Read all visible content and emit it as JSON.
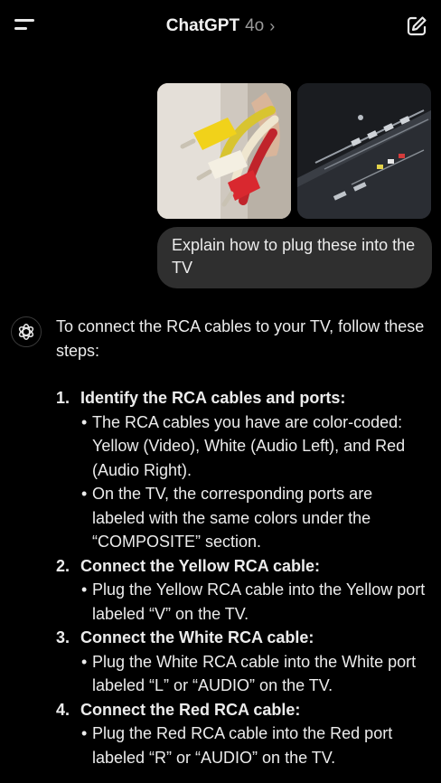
{
  "header": {
    "title": "ChatGPT",
    "model": "4o",
    "chevron": "›",
    "menu_icon": "menu-icon",
    "new_chat_icon": "new-chat-icon"
  },
  "user_message": {
    "attachments": [
      {
        "name": "rca-cables-photo"
      },
      {
        "name": "tv-ports-photo"
      }
    ],
    "text": "Explain how to plug these into the TV"
  },
  "assistant_message": {
    "avatar_icon": "openai-logo-icon",
    "intro": "To connect the RCA cables to your TV, follow these steps:",
    "steps": [
      {
        "num": "1.",
        "title": "Identify the RCA cables and ports:",
        "bullets": [
          "The RCA cables you have are color-coded: Yellow (Video), White (Audio Left), and Red (Audio Right).",
          "On the TV, the corresponding ports are labeled with the same colors under the “COMPOSITE” section."
        ]
      },
      {
        "num": "2.",
        "title": "Connect the Yellow RCA cable:",
        "bullets": [
          "Plug the Yellow RCA cable into the Yellow port labeled “V” on the TV."
        ]
      },
      {
        "num": "3.",
        "title": "Connect the White RCA cable:",
        "bullets": [
          "Plug the White RCA cable into the White port labeled “L” or “AUDIO” on the TV."
        ]
      },
      {
        "num": "4.",
        "title": "Connect the Red RCA cable:",
        "bullets": [
          "Plug the Red RCA cable into the Red port labeled “R” or “AUDIO” on the TV."
        ]
      }
    ]
  },
  "colors": {
    "background": "#000000",
    "bubble": "#2f2f2f",
    "text": "#ececec",
    "muted": "#9b9b9b"
  }
}
